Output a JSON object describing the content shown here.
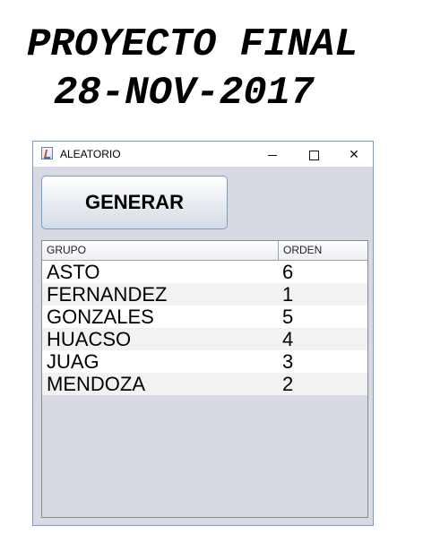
{
  "heading": {
    "line1": "PROYECTO FINAL",
    "line2": "28-NOV-2017"
  },
  "window": {
    "title": "ALEATORIO",
    "controls": {
      "minimize": "minimize",
      "maximize": "maximize",
      "close": "✕"
    }
  },
  "generate_button": "GENERAR",
  "table": {
    "columns": [
      "GRUPO",
      "ORDEN"
    ],
    "rows": [
      {
        "grupo": "ASTO",
        "orden": "6"
      },
      {
        "grupo": "FERNANDEZ",
        "orden": "1"
      },
      {
        "grupo": "GONZALES",
        "orden": "5"
      },
      {
        "grupo": "HUACSO",
        "orden": "4"
      },
      {
        "grupo": "JUAG",
        "orden": "3"
      },
      {
        "grupo": "MENDOZA",
        "orden": "2"
      }
    ]
  }
}
